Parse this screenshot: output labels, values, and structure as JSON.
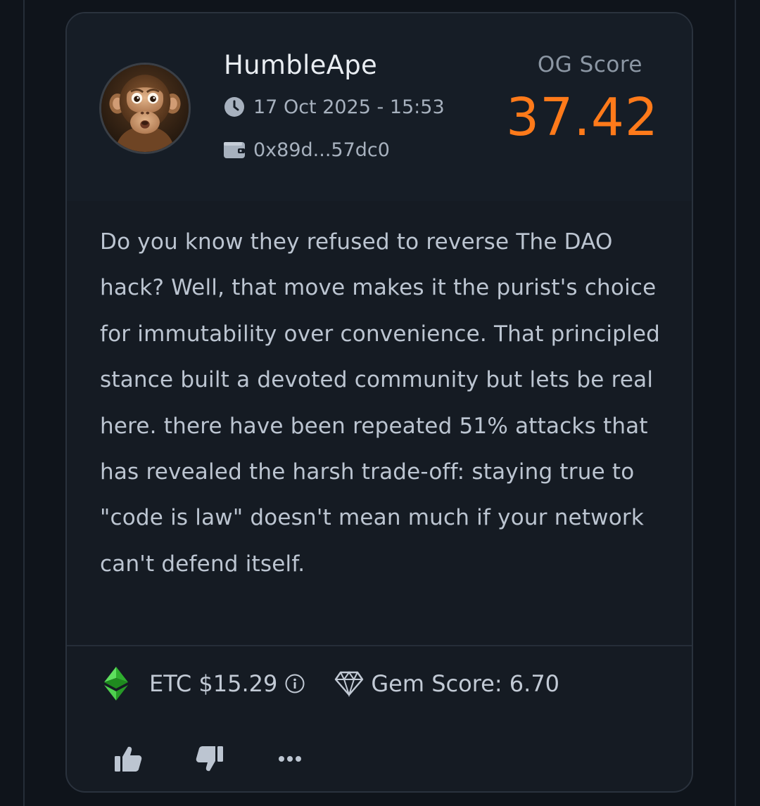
{
  "post": {
    "username": "HumbleApe",
    "timestamp": "17 Oct 2025 - 15:53",
    "wallet": "0x89d...57dc0",
    "og_score_label": "OG Score",
    "og_score_value": "37.42",
    "body": "Do you know they refused to reverse The DAO hack? Well, that move makes it the purist's choice for immutability over convenience. That principled stance built a devoted community but lets be real here. there have been repeated 51% attacks that has revealed the harsh trade-off: staying true to \"code is law\" doesn't mean much if your network can't defend itself.",
    "token_price": "ETC $15.29",
    "gem_score": "Gem Score: 6.70"
  },
  "icons": {
    "clock": "clock-icon",
    "wallet": "wallet-icon",
    "token": "ethereum-classic-icon",
    "info": "info-icon",
    "gem": "gem-icon",
    "like": "thumbs-up-icon",
    "dislike": "thumbs-down-icon",
    "more": "more-icon"
  },
  "colors": {
    "page_bg": "#0f141b",
    "card_bg": "#151b23",
    "accent_score": "#ff7a1a",
    "etc_green": "#3ab83a"
  }
}
